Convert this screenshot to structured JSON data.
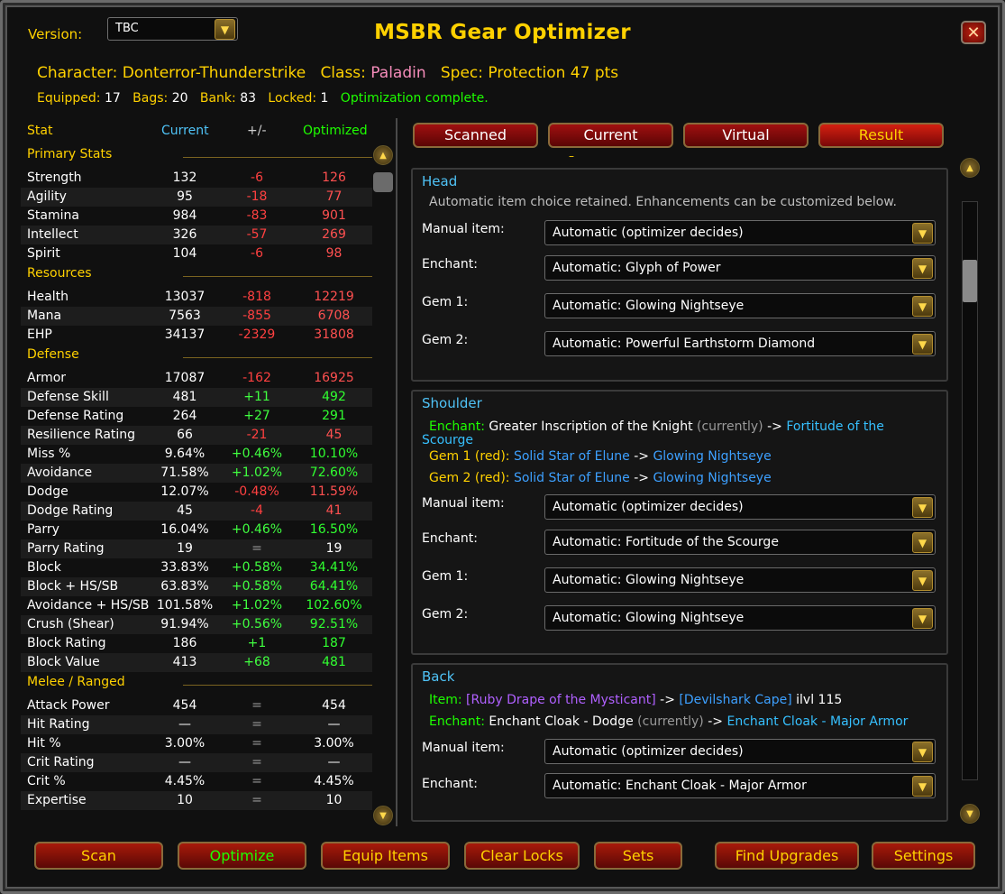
{
  "header": {
    "version_label": "Version:",
    "version_value": "TBC",
    "title": "MSBR Gear Optimizer",
    "close_glyph": "✕",
    "character_label": "Character:",
    "character_name": "Donterror-Thunderstrike",
    "class_label": "Class:",
    "class_name": "Paladin",
    "spec_label": "Spec:",
    "spec_value": "Protection 47 pts",
    "equipped_label": "Equipped:",
    "equipped": "17",
    "bags_label": "Bags:",
    "bags": "20",
    "bank_label": "Bank:",
    "bank": "83",
    "locked_label": "Locked:",
    "locked": "1",
    "status": "Optimization complete."
  },
  "stats": {
    "col_stat": "Stat",
    "col_current": "Current",
    "col_delta": "+/-",
    "col_optimized": "Optimized",
    "sections": [
      {
        "name": "Primary Stats",
        "rows": [
          {
            "n": "Strength",
            "c": "132",
            "d": "-6",
            "o": "126",
            "t": "neg"
          },
          {
            "n": "Agility",
            "c": "95",
            "d": "-18",
            "o": "77",
            "t": "neg"
          },
          {
            "n": "Stamina",
            "c": "984",
            "d": "-83",
            "o": "901",
            "t": "neg"
          },
          {
            "n": "Intellect",
            "c": "326",
            "d": "-57",
            "o": "269",
            "t": "neg"
          },
          {
            "n": "Spirit",
            "c": "104",
            "d": "-6",
            "o": "98",
            "t": "neg"
          }
        ]
      },
      {
        "name": "Resources",
        "rows": [
          {
            "n": "Health",
            "c": "13037",
            "d": "-818",
            "o": "12219",
            "t": "neg"
          },
          {
            "n": "Mana",
            "c": "7563",
            "d": "-855",
            "o": "6708",
            "t": "neg"
          },
          {
            "n": "EHP",
            "c": "34137",
            "d": "-2329",
            "o": "31808",
            "t": "neg"
          }
        ]
      },
      {
        "name": "Defense",
        "rows": [
          {
            "n": "Armor",
            "c": "17087",
            "d": "-162",
            "o": "16925",
            "t": "neg"
          },
          {
            "n": "Defense Skill",
            "c": "481",
            "d": "+11",
            "o": "492",
            "t": "pos"
          },
          {
            "n": "Defense Rating",
            "c": "264",
            "d": "+27",
            "o": "291",
            "t": "pos"
          },
          {
            "n": "Resilience Rating",
            "c": "66",
            "d": "-21",
            "o": "45",
            "t": "neg"
          },
          {
            "n": "Miss %",
            "c": "9.64%",
            "d": "+0.46%",
            "o": "10.10%",
            "t": "pos"
          },
          {
            "n": "Avoidance",
            "c": "71.58%",
            "d": "+1.02%",
            "o": "72.60%",
            "t": "pos"
          },
          {
            "n": "Dodge",
            "c": "12.07%",
            "d": "-0.48%",
            "o": "11.59%",
            "t": "neg"
          },
          {
            "n": "Dodge Rating",
            "c": "45",
            "d": "-4",
            "o": "41",
            "t": "neg"
          },
          {
            "n": "Parry",
            "c": "16.04%",
            "d": "+0.46%",
            "o": "16.50%",
            "t": "pos"
          },
          {
            "n": "Parry Rating",
            "c": "19",
            "d": "=",
            "o": "19",
            "t": "eq"
          },
          {
            "n": "Block",
            "c": "33.83%",
            "d": "+0.58%",
            "o": "34.41%",
            "t": "pos"
          },
          {
            "n": "Block + HS/SB",
            "c": "63.83%",
            "d": "+0.58%",
            "o": "64.41%",
            "t": "pos"
          },
          {
            "n": "Avoidance + HS/SB",
            "c": "101.58%",
            "d": "+1.02%",
            "o": "102.60%",
            "t": "pos"
          },
          {
            "n": "Crush (Shear)",
            "c": "91.94%",
            "d": "+0.56%",
            "o": "92.51%",
            "t": "pos"
          },
          {
            "n": "Block Rating",
            "c": "186",
            "d": "+1",
            "o": "187",
            "t": "pos"
          },
          {
            "n": "Block Value",
            "c": "413",
            "d": "+68",
            "o": "481",
            "t": "pos"
          }
        ]
      },
      {
        "name": "Melee / Ranged",
        "rows": [
          {
            "n": "Attack Power",
            "c": "454",
            "d": "=",
            "o": "454",
            "t": "eq"
          },
          {
            "n": "Hit Rating",
            "c": "—",
            "d": "=",
            "o": "—",
            "t": "eq"
          },
          {
            "n": "Hit %",
            "c": "3.00%",
            "d": "=",
            "o": "3.00%",
            "t": "eq"
          },
          {
            "n": "Crit Rating",
            "c": "—",
            "d": "=",
            "o": "—",
            "t": "eq"
          },
          {
            "n": "Crit %",
            "c": "4.45%",
            "d": "=",
            "o": "4.45%",
            "t": "eq"
          },
          {
            "n": "Expertise",
            "c": "10",
            "d": "=",
            "o": "10",
            "t": "eq"
          }
        ]
      }
    ]
  },
  "tabs": [
    "Scanned",
    "Current",
    "Virtual",
    "Result"
  ],
  "tab_dash": "–",
  "slots": {
    "head": {
      "title": "Head",
      "note": "Automatic item choice retained. Enhancements can be customized below.",
      "fields": [
        {
          "label": "Manual item:",
          "value": "Automatic (optimizer decides)"
        },
        {
          "label": "Enchant:",
          "value": "Automatic: Glyph of Power"
        },
        {
          "label": "Gem 1:",
          "value": "Automatic: Glowing Nightseye"
        },
        {
          "label": "Gem 2:",
          "value": "Automatic: Powerful Earthstorm Diamond"
        }
      ]
    },
    "shoulder": {
      "title": "Shoulder",
      "enchant_label": "Enchant:",
      "enchant_from": "Greater Inscription of the Knight",
      "currently": "(currently)",
      "arrow": "->",
      "enchant_to_1": "Fortitude of the",
      "enchant_to_2": "Scourge",
      "gem1_label": "Gem 1 (red):",
      "gem1_from": "Solid Star of Elune",
      "gem1_to": "Glowing Nightseye",
      "gem2_label": "Gem 2 (red):",
      "gem2_from": "Solid Star of Elune",
      "gem2_to": "Glowing Nightseye",
      "fields": [
        {
          "label": "Manual item:",
          "value": "Automatic (optimizer decides)"
        },
        {
          "label": "Enchant:",
          "value": "Automatic: Fortitude of the Scourge"
        },
        {
          "label": "Gem 1:",
          "value": "Automatic: Glowing Nightseye"
        },
        {
          "label": "Gem 2:",
          "value": "Automatic: Glowing Nightseye"
        }
      ]
    },
    "back": {
      "title": "Back",
      "item_label": "Item:",
      "item_from": "[Ruby Drape of the Mysticant]",
      "arrow": "->",
      "item_to": "[Devilshark Cape]",
      "ilvl": "ilvl 115",
      "enchant_label": "Enchant:",
      "enchant_from": "Enchant Cloak - Dodge",
      "currently": "(currently)",
      "enchant_to": "Enchant Cloak - Major Armor",
      "fields": [
        {
          "label": "Manual item:",
          "value": "Automatic (optimizer decides)"
        },
        {
          "label": "Enchant:",
          "value": "Automatic: Enchant Cloak - Major Armor"
        }
      ]
    }
  },
  "buttons": {
    "scan": "Scan",
    "optimize": "Optimize",
    "equip": "Equip Items",
    "clear": "Clear Locks",
    "sets": "Sets",
    "upgrades": "Find Upgrades",
    "settings": "Settings"
  },
  "icons": {
    "dropdown": "chevron-down-icon",
    "close": "close-icon",
    "scroll_up": "scroll-up-icon",
    "scroll_down": "scroll-down-icon"
  },
  "colors": {
    "gold": "#ffd100",
    "good": "#1eff00",
    "bad": "#ff4040",
    "link": "#3ea6ff",
    "paladin": "#f58cba"
  }
}
